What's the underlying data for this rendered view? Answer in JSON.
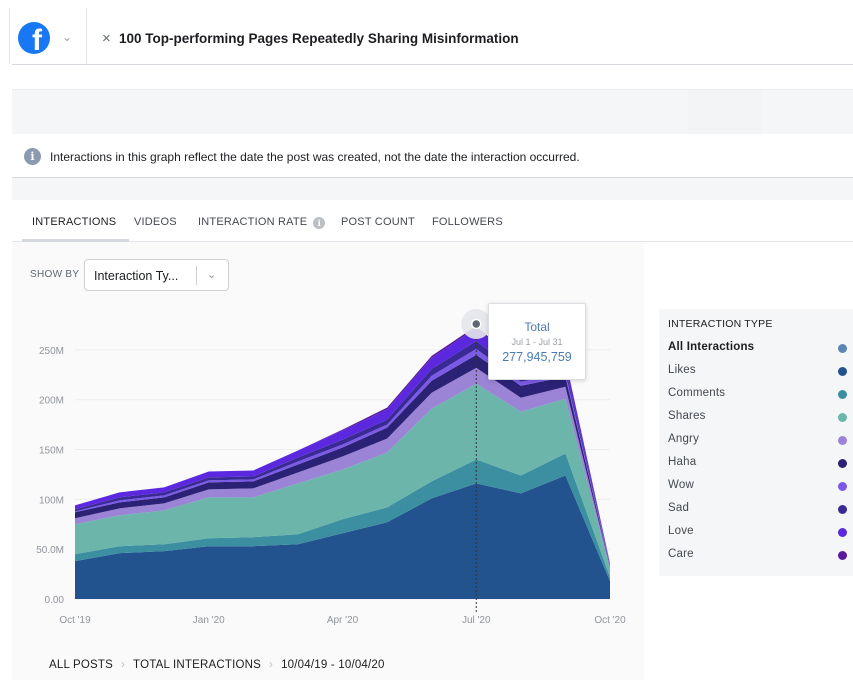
{
  "header": {
    "title": "100 Top-performing Pages Repeatedly Sharing Misinformation",
    "logo_glyph": "f",
    "close_glyph": "×",
    "menu_chevron": "⌄"
  },
  "info": {
    "icon_glyph": "i",
    "text": "Interactions in this graph reflect the date the post was created, not the date the interaction occurred."
  },
  "tabs": [
    {
      "label": "INTERACTIONS",
      "active": true
    },
    {
      "label": "VIDEOS",
      "active": false
    },
    {
      "label": "INTERACTION RATE",
      "active": false,
      "info_glyph": "i"
    },
    {
      "label": "POST COUNT",
      "active": false
    },
    {
      "label": "FOLLOWERS",
      "active": false
    }
  ],
  "show_by": {
    "label": "SHOW BY",
    "selected": "Interaction Ty...",
    "chevron": "⌄"
  },
  "tooltip": {
    "title": "Total",
    "range": "Jul 1 - Jul 31",
    "value": "277,945,759"
  },
  "legend": {
    "title": "INTERACTION TYPE",
    "items": [
      {
        "label": "All Interactions",
        "color": "#5b86b5",
        "bold": true
      },
      {
        "label": "Likes",
        "color": "#23538f",
        "bold": false
      },
      {
        "label": "Comments",
        "color": "#3b8fa0",
        "bold": false
      },
      {
        "label": "Shares",
        "color": "#6bb5ab",
        "bold": false
      },
      {
        "label": "Angry",
        "color": "#9b83d6",
        "bold": false
      },
      {
        "label": "Haha",
        "color": "#2b2276",
        "bold": false
      },
      {
        "label": "Wow",
        "color": "#7b5ae8",
        "bold": false
      },
      {
        "label": "Sad",
        "color": "#3a2a96",
        "bold": false
      },
      {
        "label": "Love",
        "color": "#5b28e0",
        "bold": false
      },
      {
        "label": "Care",
        "color": "#5a1a9e",
        "bold": false
      }
    ]
  },
  "breadcrumbs": {
    "items": [
      "ALL POSTS",
      "TOTAL INTERACTIONS",
      "10/04/19 - 10/04/20"
    ],
    "separator": "›"
  },
  "chart_data": {
    "type": "area",
    "stacked": true,
    "x": [
      "Oct '19",
      "Nov '19",
      "Dec '19",
      "Jan '20",
      "Feb '20",
      "Mar '20",
      "Apr '20",
      "May '20",
      "Jun '20",
      "Jul '20",
      "Aug '20",
      "Sep '20",
      "Oct '20"
    ],
    "x_tick_labels": [
      "Oct '19",
      "Jan '20",
      "Apr '20",
      "Jul '20",
      "Oct '20"
    ],
    "y_tick_labels": [
      "0.00",
      "50.0M",
      "100M",
      "150M",
      "200M",
      "250M"
    ],
    "ylim": [
      0,
      280000000
    ],
    "grid": true,
    "legend_placement": "right",
    "series": [
      {
        "name": "Likes",
        "color": "#23538f",
        "values": [
          38,
          46,
          48,
          53,
          53,
          55,
          66,
          77,
          101,
          116,
          106,
          124,
          18
        ]
      },
      {
        "name": "Comments",
        "color": "#3b8fa0",
        "values": [
          7,
          7,
          7,
          8,
          9,
          10,
          14,
          15,
          17,
          24,
          18,
          22,
          4
        ]
      },
      {
        "name": "Shares",
        "color": "#6bb5ab",
        "values": [
          30,
          31,
          34,
          41,
          40,
          51,
          50,
          55,
          73,
          76,
          64,
          55,
          8
        ]
      },
      {
        "name": "Angry",
        "color": "#9b83d6",
        "values": [
          6,
          7,
          7,
          8,
          9,
          11,
          13,
          14,
          16,
          16,
          14,
          12,
          2
        ]
      },
      {
        "name": "Haha",
        "color": "#2b2276",
        "values": [
          6,
          6,
          6,
          7,
          7,
          8,
          9,
          11,
          12,
          13,
          12,
          10,
          1
        ]
      },
      {
        "name": "Wow",
        "color": "#7b5ae8",
        "values": [
          1,
          2,
          2,
          2,
          2,
          3,
          3,
          3,
          5,
          6,
          4,
          4,
          1
        ]
      },
      {
        "name": "Sad",
        "color": "#3a2a96",
        "values": [
          2,
          3,
          3,
          3,
          3,
          4,
          5,
          5,
          7,
          8,
          6,
          5,
          1
        ]
      },
      {
        "name": "Love",
        "color": "#5b28e0",
        "values": [
          4,
          5,
          5,
          6,
          6,
          7,
          9,
          10,
          11,
          13,
          10,
          8,
          1
        ]
      },
      {
        "name": "Care",
        "color": "#5a1a9e",
        "values": [
          0,
          0,
          0,
          0,
          0,
          0,
          1,
          2,
          2,
          2,
          1,
          1,
          0
        ]
      }
    ],
    "values_unit": "millions",
    "highlight": {
      "x": "Jul '20",
      "total": 277945759
    }
  }
}
